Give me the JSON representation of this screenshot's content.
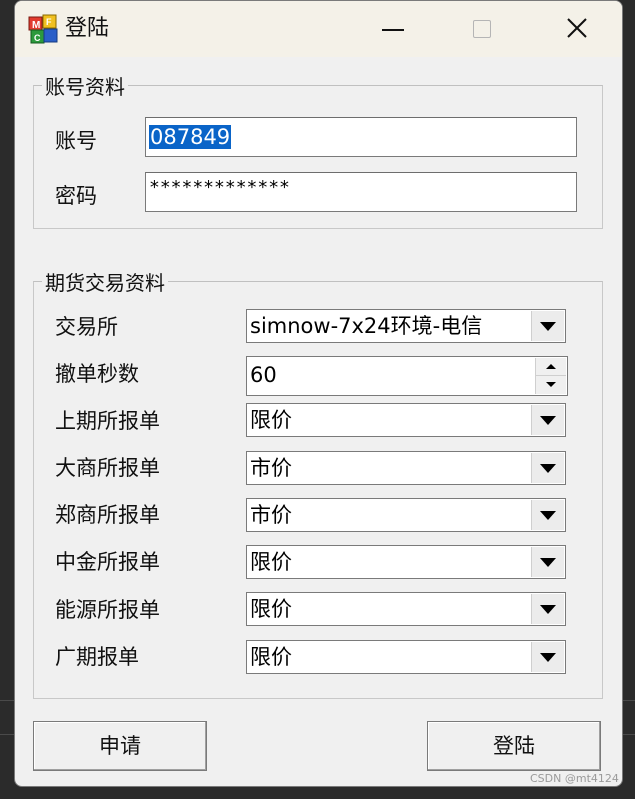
{
  "window": {
    "title": "登陆",
    "icon": "mfc-app-icon",
    "controls": [
      "minimize",
      "maximize",
      "close"
    ]
  },
  "account_group": {
    "legend": "账号资料",
    "account_label": "账号",
    "account_value": "087849",
    "password_label": "密码",
    "password_value": "*************"
  },
  "trade_group": {
    "legend": "期货交易资料",
    "exchange_label": "交易所",
    "exchange_value": "simnow-7x24环境-电信",
    "cancel_seconds_label": "撤单秒数",
    "cancel_seconds_value": "60",
    "shfe_label": "上期所报单",
    "shfe_value": "限价",
    "dce_label": "大商所报单",
    "dce_value": "市价",
    "czce_label": "郑商所报单",
    "czce_value": "市价",
    "cffex_label": "中金所报单",
    "cffex_value": "限价",
    "ine_label": "能源所报单",
    "ine_value": "限价",
    "gfex_label": "广期报单",
    "gfex_value": "限价"
  },
  "buttons": {
    "apply": "申请",
    "login": "登陆"
  },
  "watermark": "CSDN @mt4124",
  "colors": {
    "titlebar": "#f4f1e8",
    "window_bg": "#f0f0f0",
    "selection": "#0a64c8"
  }
}
